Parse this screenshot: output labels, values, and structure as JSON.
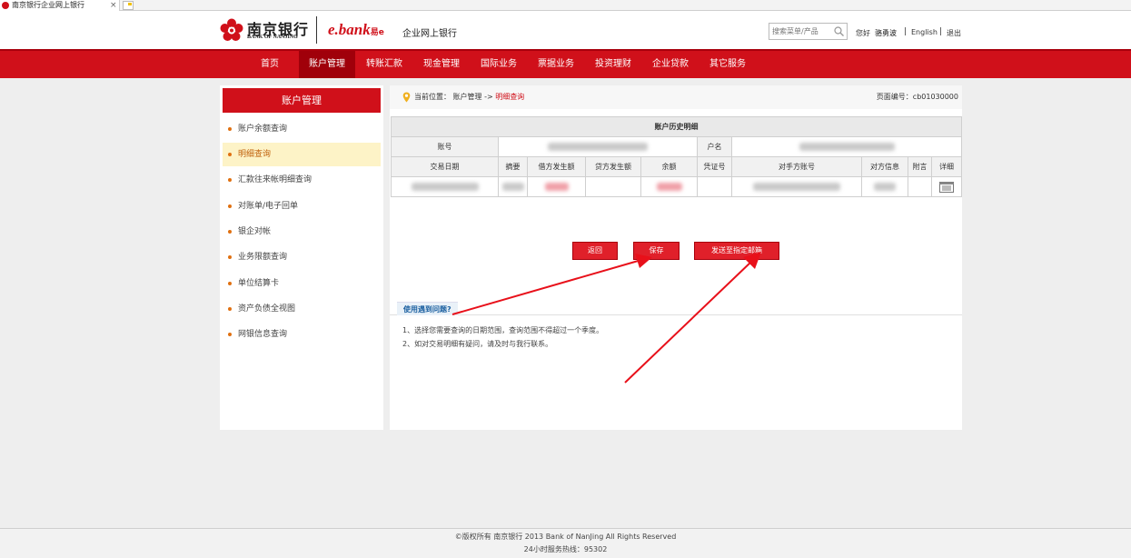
{
  "browser": {
    "tab_title": "南京银行企业网上银行",
    "close_glyph": "×"
  },
  "header": {
    "bank_name_cn": "南京银行",
    "bank_name_en": "BANK OF NANJING",
    "ebank_main": "e.bank",
    "ebank_sub": "易e",
    "site_title": "企业网上银行",
    "search_placeholder": "搜索菜单/产品",
    "greeting": "您好",
    "user_name": "骆勇波",
    "separator": "|",
    "lang_link": "English",
    "logout": "退出"
  },
  "nav": {
    "items": [
      "首页",
      "账户管理",
      "转账汇款",
      "现金管理",
      "国际业务",
      "票据业务",
      "投资理财",
      "企业贷款",
      "其它服务"
    ],
    "active_index": 1
  },
  "sidebar": {
    "title": "账户管理",
    "items": [
      "账户余额查询",
      "明细查询",
      "汇款往来帐明细查询",
      "对账单/电子回单",
      "银企对帐",
      "业务限额查询",
      "单位结算卡",
      "资产负债全视图",
      "网银信息查询"
    ],
    "active_index": 1
  },
  "location": {
    "label": "当前位置：",
    "path": "账户管理 ->",
    "current": "明细查询",
    "page_no": "页面编号：cb01030000"
  },
  "table": {
    "caption": "账户历史明细",
    "account_label": "账号",
    "name_label": "户名",
    "columns": [
      "交易日期",
      "摘要",
      "借方发生额",
      "贷方发生额",
      "余额",
      "凭证号",
      "对手方账号",
      "对方信息",
      "附言",
      "详细"
    ]
  },
  "buttons": {
    "back": "返回",
    "save": "保存",
    "send": "发送至指定邮箱"
  },
  "help": {
    "tab_label": "使用遇到问题?",
    "tips": [
      "1、选择您需要查询的日期范围，查询范围不得超过一个季度。",
      "2、如对交易明细有疑问，请及时与我行联系。"
    ]
  },
  "footer": {
    "copyright": "©版权所有 南京银行 2013 Bank of NanJing All Rights Reserved",
    "hotline": "24小时服务热线：95302"
  },
  "colors": {
    "brand_red": "#d0101a",
    "nav_active": "#a0000a",
    "sidebar_active_bg": "#fdf3c7",
    "annotation_arrow": "#e8101a"
  }
}
